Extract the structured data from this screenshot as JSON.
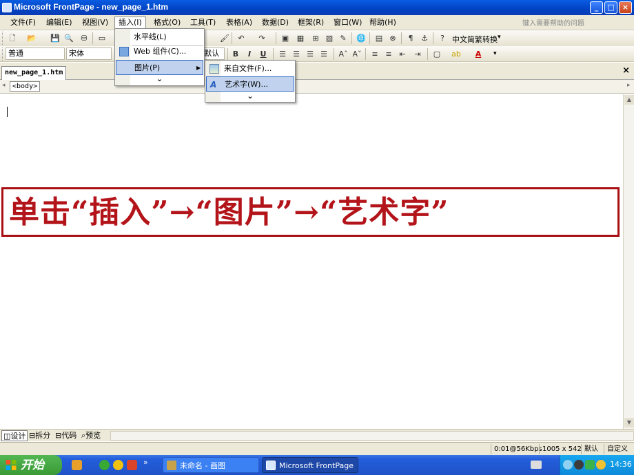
{
  "window": {
    "title": "Microsoft FrontPage - new_page_1.htm",
    "controls": {
      "minimize": "_",
      "maximize": "□",
      "close": "×"
    }
  },
  "menubar": {
    "items": [
      {
        "label": "文件(F)"
      },
      {
        "label": "编辑(E)"
      },
      {
        "label": "视图(V)"
      },
      {
        "label": "插入(I)"
      },
      {
        "label": "格式(O)"
      },
      {
        "label": "工具(T)"
      },
      {
        "label": "表格(A)"
      },
      {
        "label": "数据(D)"
      },
      {
        "label": "框架(R)"
      },
      {
        "label": "窗口(W)"
      },
      {
        "label": "帮助(H)"
      }
    ],
    "help_placeholder": "键入需要帮助的问题"
  },
  "toolbar": {
    "style_value": "普通",
    "font_value": "宋体",
    "size_value": "(默认字号)",
    "convert_label": "中文简繁转换",
    "bold": "B",
    "italic": "I",
    "underline": "U"
  },
  "insert_menu": {
    "items": [
      {
        "label": "水平线(L)"
      },
      {
        "label": "Web 组件(C)..."
      },
      {
        "label": "图片(P)",
        "arrow": "▶"
      }
    ],
    "more": "⌄"
  },
  "picture_submenu": {
    "items": [
      {
        "label": "来自文件(F)..."
      },
      {
        "label": "艺术字(W)..."
      }
    ],
    "more": "⌄"
  },
  "document": {
    "tab_label": "new_page_1.htm",
    "close": "×",
    "tag": "<body>"
  },
  "annotation": {
    "text": "单击“插入”→“图片”→“艺术字”"
  },
  "viewbar": {
    "tabs": [
      {
        "label": "设计",
        "icon": "design-icon"
      },
      {
        "label": "拆分",
        "icon": "split-icon"
      },
      {
        "label": "代码",
        "icon": "code-icon"
      },
      {
        "label": "预览",
        "icon": "preview-icon"
      }
    ]
  },
  "statusbar": {
    "download": "0:01@56Kbps",
    "page_size": "1005 x 542",
    "mode": "默认",
    "custom": "自定义"
  },
  "taskbar": {
    "start_label": "开始",
    "tasks": [
      {
        "label": "未命名 - 画图"
      },
      {
        "label": "Microsoft FrontPage -..."
      }
    ],
    "clock": "14:36"
  },
  "colors": {
    "accent_red": "#b3141a",
    "titlebar_blue": "#0143c4",
    "taskbar_blue": "#245edb",
    "start_green": "#3a9a36"
  }
}
